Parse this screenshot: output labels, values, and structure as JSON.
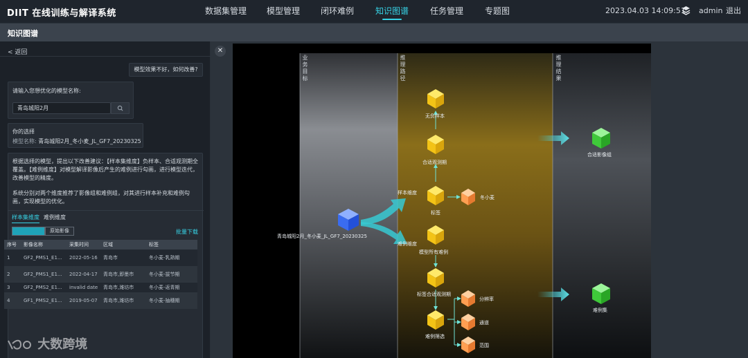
{
  "app": {
    "logo": "DIIT",
    "title": "在线训练与解译系统"
  },
  "nav": [
    "数据集管理",
    "模型管理",
    "闭环难例",
    "知识图谱",
    "任务管理",
    "专题图"
  ],
  "nav_active": 3,
  "header": {
    "datetime": "2023.04.03 14:09:51",
    "user": "admin",
    "logout": "退出"
  },
  "page_title": "知识图谱",
  "chat": {
    "back": "< 返回",
    "user_question": "模型效果不好，如何改善?",
    "prompt_label": "请输入您想优化的模型名称:",
    "input_value": "青岛城阳2月",
    "choice_title": "你的选择",
    "choice_key": "模型名称:",
    "choice_value": "青岛城阳2月_冬小麦_JL_GF7_20230325",
    "advice_p1": "根据选择的模型，提出以下改善建议：【样本集维度】负样本、合适观测期全覆盖。【难例维度】对模型解译影像后产生的难例进行勾画，进行模型迭代，改善模型的精度。",
    "advice_p2": "系统分别对两个维度推荐了影像组和难例组，对其进行样本补充和难例勾画，实现模型的优化。",
    "tab_sample": "样本集维度",
    "tab_hard": "难例维度",
    "seg_active": "",
    "seg_original": "原始影像",
    "bulk_download": "批量下载",
    "table_headers": [
      "序号",
      "影像名称",
      "采集时间",
      "区域",
      "标签"
    ],
    "rows": [
      [
        "1",
        "GF2_PMS1_E1...",
        "2022-05-16",
        "青岛市",
        "冬小麦-乳熟期"
      ],
      [
        "2",
        "GF2_PMS1_E1...",
        "2022-04-17",
        "青岛市,即墨市",
        "冬小麦-拔节期"
      ],
      [
        "3",
        "GF2_PMS2_E1...",
        "invalid date",
        "青岛市,潍坊市",
        "冬小麦-返青期"
      ],
      [
        "4",
        "GF1_PMS2_E1...",
        "2019-05-07",
        "青岛市,潍坊市",
        "冬小麦-抽穗期"
      ]
    ]
  },
  "watermark": "大数跨境",
  "graph": {
    "lanes": [
      "业务目标",
      "推理路径",
      "推理结果"
    ],
    "model_node": "青岛城阳2月_冬小麦_JL_GF7_20230325",
    "branch_upper": "样本维度",
    "branch_lower": "难例维度",
    "nodes": {
      "neg": "无负样本",
      "period": "合适观测期",
      "label": "标签",
      "wheat": "冬小麦",
      "allhard": "模型所有难例",
      "labelperiod": "标签合适观测期",
      "hardfilter": "难例筛选",
      "res": "分辨率",
      "channel": "通道",
      "range": "范围"
    },
    "results": [
      "合适影像组",
      "难例集"
    ]
  }
}
